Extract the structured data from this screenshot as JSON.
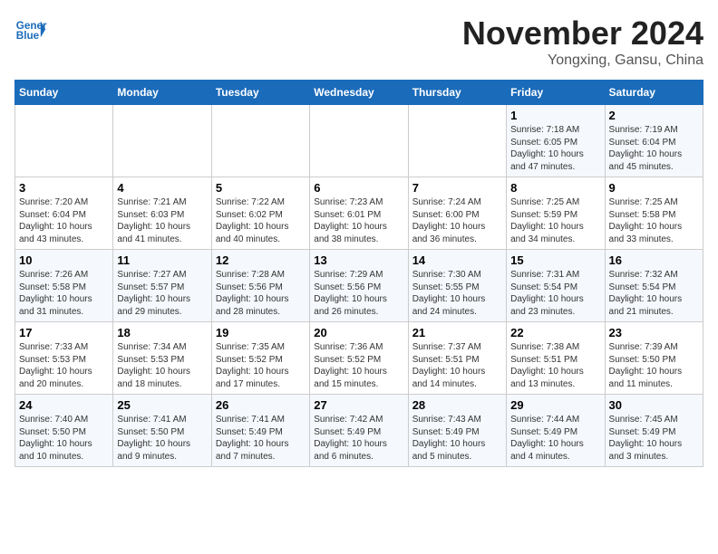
{
  "header": {
    "logo_line1": "General",
    "logo_line2": "Blue",
    "month": "November 2024",
    "location": "Yongxing, Gansu, China"
  },
  "days_of_week": [
    "Sunday",
    "Monday",
    "Tuesday",
    "Wednesday",
    "Thursday",
    "Friday",
    "Saturday"
  ],
  "weeks": [
    [
      {
        "day": "",
        "info": ""
      },
      {
        "day": "",
        "info": ""
      },
      {
        "day": "",
        "info": ""
      },
      {
        "day": "",
        "info": ""
      },
      {
        "day": "",
        "info": ""
      },
      {
        "day": "1",
        "info": "Sunrise: 7:18 AM\nSunset: 6:05 PM\nDaylight: 10 hours and 47 minutes."
      },
      {
        "day": "2",
        "info": "Sunrise: 7:19 AM\nSunset: 6:04 PM\nDaylight: 10 hours and 45 minutes."
      }
    ],
    [
      {
        "day": "3",
        "info": "Sunrise: 7:20 AM\nSunset: 6:04 PM\nDaylight: 10 hours and 43 minutes."
      },
      {
        "day": "4",
        "info": "Sunrise: 7:21 AM\nSunset: 6:03 PM\nDaylight: 10 hours and 41 minutes."
      },
      {
        "day": "5",
        "info": "Sunrise: 7:22 AM\nSunset: 6:02 PM\nDaylight: 10 hours and 40 minutes."
      },
      {
        "day": "6",
        "info": "Sunrise: 7:23 AM\nSunset: 6:01 PM\nDaylight: 10 hours and 38 minutes."
      },
      {
        "day": "7",
        "info": "Sunrise: 7:24 AM\nSunset: 6:00 PM\nDaylight: 10 hours and 36 minutes."
      },
      {
        "day": "8",
        "info": "Sunrise: 7:25 AM\nSunset: 5:59 PM\nDaylight: 10 hours and 34 minutes."
      },
      {
        "day": "9",
        "info": "Sunrise: 7:25 AM\nSunset: 5:58 PM\nDaylight: 10 hours and 33 minutes."
      }
    ],
    [
      {
        "day": "10",
        "info": "Sunrise: 7:26 AM\nSunset: 5:58 PM\nDaylight: 10 hours and 31 minutes."
      },
      {
        "day": "11",
        "info": "Sunrise: 7:27 AM\nSunset: 5:57 PM\nDaylight: 10 hours and 29 minutes."
      },
      {
        "day": "12",
        "info": "Sunrise: 7:28 AM\nSunset: 5:56 PM\nDaylight: 10 hours and 28 minutes."
      },
      {
        "day": "13",
        "info": "Sunrise: 7:29 AM\nSunset: 5:56 PM\nDaylight: 10 hours and 26 minutes."
      },
      {
        "day": "14",
        "info": "Sunrise: 7:30 AM\nSunset: 5:55 PM\nDaylight: 10 hours and 24 minutes."
      },
      {
        "day": "15",
        "info": "Sunrise: 7:31 AM\nSunset: 5:54 PM\nDaylight: 10 hours and 23 minutes."
      },
      {
        "day": "16",
        "info": "Sunrise: 7:32 AM\nSunset: 5:54 PM\nDaylight: 10 hours and 21 minutes."
      }
    ],
    [
      {
        "day": "17",
        "info": "Sunrise: 7:33 AM\nSunset: 5:53 PM\nDaylight: 10 hours and 20 minutes."
      },
      {
        "day": "18",
        "info": "Sunrise: 7:34 AM\nSunset: 5:53 PM\nDaylight: 10 hours and 18 minutes."
      },
      {
        "day": "19",
        "info": "Sunrise: 7:35 AM\nSunset: 5:52 PM\nDaylight: 10 hours and 17 minutes."
      },
      {
        "day": "20",
        "info": "Sunrise: 7:36 AM\nSunset: 5:52 PM\nDaylight: 10 hours and 15 minutes."
      },
      {
        "day": "21",
        "info": "Sunrise: 7:37 AM\nSunset: 5:51 PM\nDaylight: 10 hours and 14 minutes."
      },
      {
        "day": "22",
        "info": "Sunrise: 7:38 AM\nSunset: 5:51 PM\nDaylight: 10 hours and 13 minutes."
      },
      {
        "day": "23",
        "info": "Sunrise: 7:39 AM\nSunset: 5:50 PM\nDaylight: 10 hours and 11 minutes."
      }
    ],
    [
      {
        "day": "24",
        "info": "Sunrise: 7:40 AM\nSunset: 5:50 PM\nDaylight: 10 hours and 10 minutes."
      },
      {
        "day": "25",
        "info": "Sunrise: 7:41 AM\nSunset: 5:50 PM\nDaylight: 10 hours and 9 minutes."
      },
      {
        "day": "26",
        "info": "Sunrise: 7:41 AM\nSunset: 5:49 PM\nDaylight: 10 hours and 7 minutes."
      },
      {
        "day": "27",
        "info": "Sunrise: 7:42 AM\nSunset: 5:49 PM\nDaylight: 10 hours and 6 minutes."
      },
      {
        "day": "28",
        "info": "Sunrise: 7:43 AM\nSunset: 5:49 PM\nDaylight: 10 hours and 5 minutes."
      },
      {
        "day": "29",
        "info": "Sunrise: 7:44 AM\nSunset: 5:49 PM\nDaylight: 10 hours and 4 minutes."
      },
      {
        "day": "30",
        "info": "Sunrise: 7:45 AM\nSunset: 5:49 PM\nDaylight: 10 hours and 3 minutes."
      }
    ]
  ]
}
